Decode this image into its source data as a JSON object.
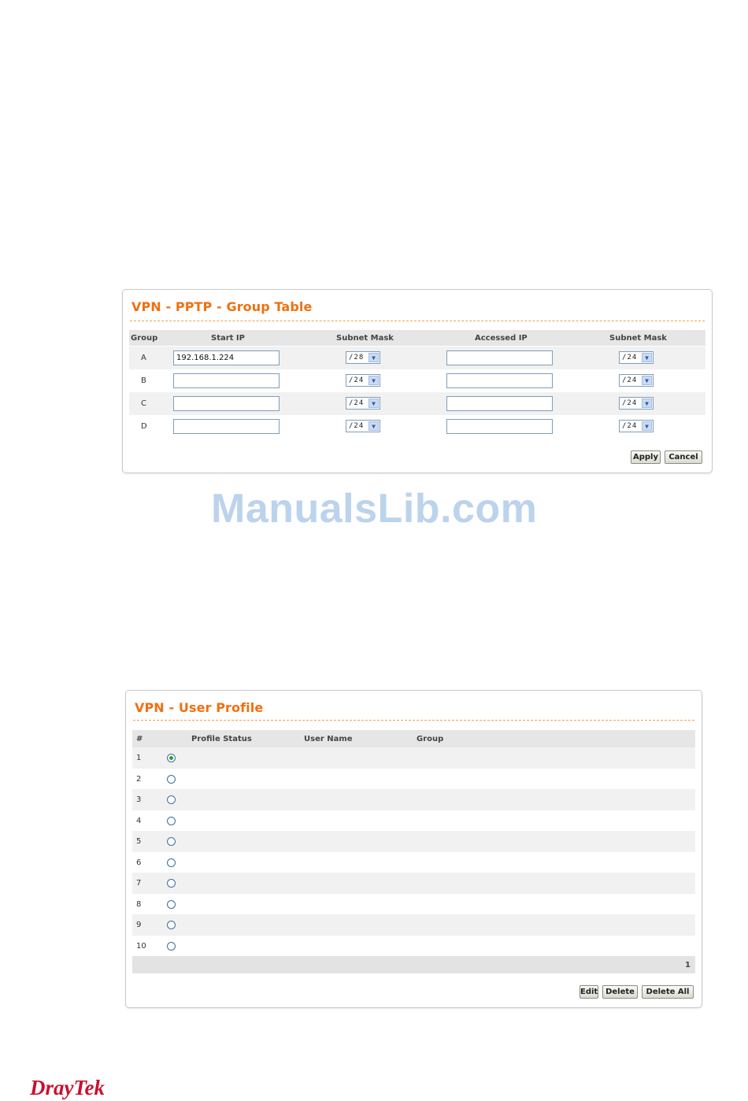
{
  "group_table": {
    "title": "VPN - PPTP - Group Table",
    "headers": [
      "Group",
      "Start IP",
      "Subnet Mask",
      "Accessed IP",
      "Subnet Mask"
    ],
    "rows": [
      {
        "group": "A",
        "start_ip": "192.168.1.224",
        "mask1": "/28",
        "accessed_ip": "",
        "mask2": "/24"
      },
      {
        "group": "B",
        "start_ip": "",
        "mask1": "/24",
        "accessed_ip": "",
        "mask2": "/24"
      },
      {
        "group": "C",
        "start_ip": "",
        "mask1": "/24",
        "accessed_ip": "",
        "mask2": "/24"
      },
      {
        "group": "D",
        "start_ip": "",
        "mask1": "/24",
        "accessed_ip": "",
        "mask2": "/24"
      }
    ],
    "apply_label": "Apply",
    "cancel_label": "Cancel"
  },
  "watermark": "ManualsLib.com",
  "user_profile": {
    "title": "VPN - User Profile",
    "headers": [
      "#",
      "Profile Status",
      "User Name",
      "Group"
    ],
    "rows": [
      {
        "num": "1",
        "selected": true
      },
      {
        "num": "2",
        "selected": false
      },
      {
        "num": "3",
        "selected": false
      },
      {
        "num": "4",
        "selected": false
      },
      {
        "num": "5",
        "selected": false
      },
      {
        "num": "6",
        "selected": false
      },
      {
        "num": "7",
        "selected": false
      },
      {
        "num": "8",
        "selected": false
      },
      {
        "num": "9",
        "selected": false
      },
      {
        "num": "10",
        "selected": false
      }
    ],
    "page_number": "1",
    "edit_label": "Edit",
    "delete_label": "Delete",
    "delete_all_label": "Delete All"
  },
  "logo": "DrayTek",
  "colors": {
    "title": "#f07010",
    "logo": "#c8102e",
    "watermark": "#bcd3ec"
  }
}
